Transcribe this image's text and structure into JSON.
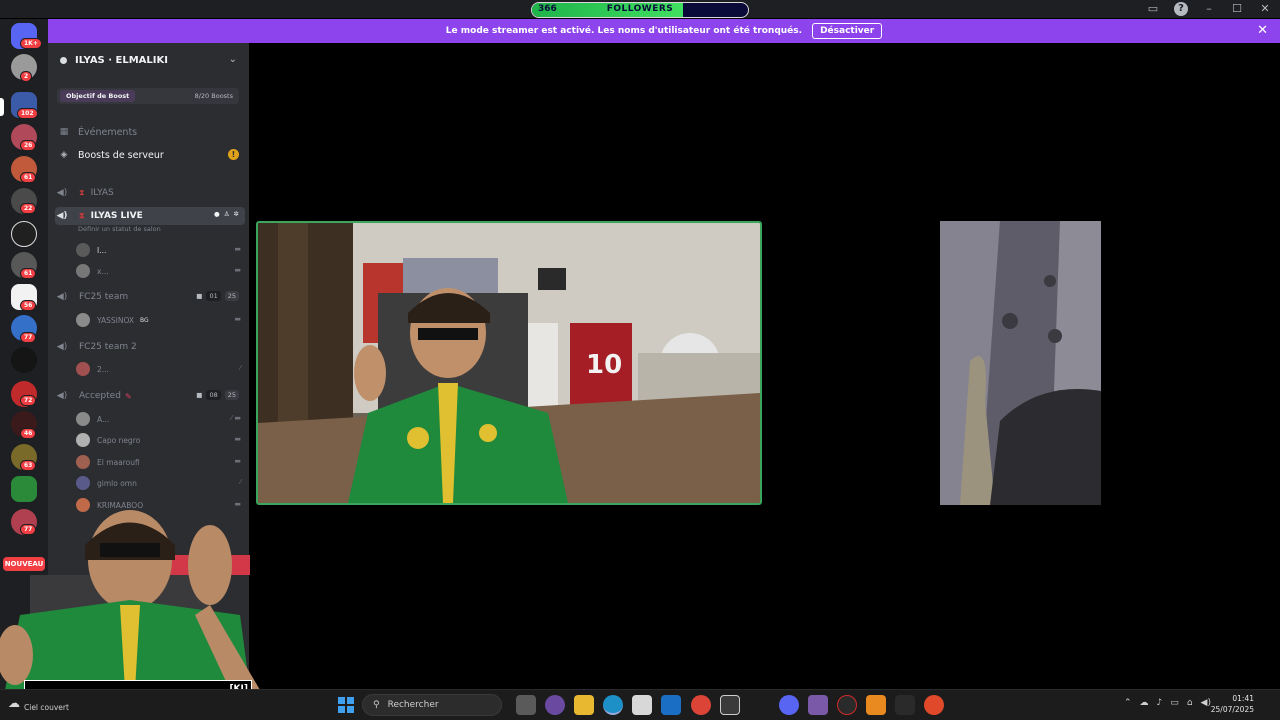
{
  "overlay": {
    "followers_count": "366",
    "followers_label": "FOLLOWERS",
    "followers_progress": 0.7,
    "cam_caption": "",
    "cam_caption_tag": "[KI]"
  },
  "banner": {
    "text": "Le mode streamer est activé. Les noms d'utilisateur ont été tronqués.",
    "button": "Désactiver"
  },
  "rail": {
    "badges": [
      "1K+",
      "2",
      "102",
      "26",
      "61",
      "22",
      "61",
      "56",
      "77",
      "72",
      "46",
      "63",
      "77"
    ],
    "new_label": "NOUVEAU"
  },
  "server": {
    "name": "ILYAS · ELMALIKI",
    "boost_goal_label": "Objectif de Boost",
    "boost_count": "8/20 Boosts"
  },
  "nav": {
    "events": "Événements",
    "boosts": "Boosts de serveur"
  },
  "channels": {
    "ilyas": "ILYAS",
    "ilyas_live": "ILYAS LIVE",
    "status_hint": "Définir un statut de salon",
    "fc25_team": "FC25 team",
    "fc25_team_a": "01",
    "fc25_team_b": "25",
    "fc25_team2": "FC25 team 2",
    "accepted": "Accepted",
    "accepted_a": "08",
    "accepted_b": "25"
  },
  "users": {
    "live_1": "I...",
    "live_2": "x...",
    "fc_user": "YASSINOX",
    "fc_user_tag": "BG",
    "team2_user": "2...",
    "acc_1": "A...",
    "acc_2": "Capo negro",
    "acc_3": "El maaroufi",
    "acc_4": "gimlo omn",
    "acc_5": "KRIMAABOO"
  },
  "taskbar": {
    "weather": "Ciel couvert",
    "search_placeholder": "Rechercher",
    "time": "01:41",
    "date": "25/07/2025"
  },
  "colors": {
    "discord_dark": "#1e1f22",
    "sidebar": "#2b2d31",
    "banner": "#8d44ed",
    "speaking": "#3ba55d",
    "badge": "#f23f43"
  }
}
